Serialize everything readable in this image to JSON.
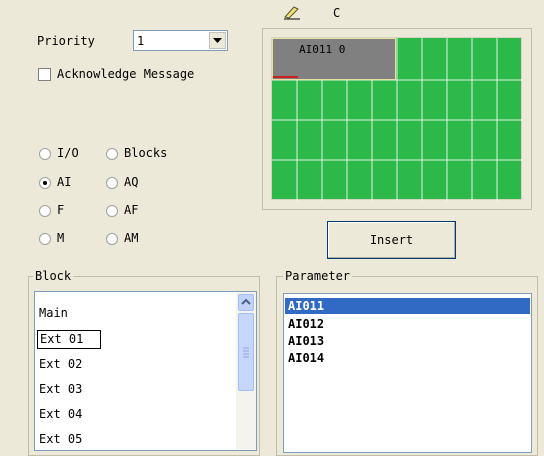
{
  "toolbar": {
    "c_label": "C",
    "icon": "pencil-icon"
  },
  "priority": {
    "label": "Priority",
    "value": "1"
  },
  "acknowledge": {
    "label": "Acknowledge Message",
    "checked": false
  },
  "radios": [
    {
      "label": "I/O",
      "checked": false
    },
    {
      "label": "Blocks",
      "checked": false
    },
    {
      "label": "AI",
      "checked": true
    },
    {
      "label": "AQ",
      "checked": false
    },
    {
      "label": "F",
      "checked": false
    },
    {
      "label": "AF",
      "checked": false
    },
    {
      "label": "M",
      "checked": false
    },
    {
      "label": "AM",
      "checked": false
    }
  ],
  "grid": {
    "selected_block_label": "AI011 0",
    "color": "#2db84a",
    "selected_color": "#808080"
  },
  "insert_button": {
    "label": "Insert"
  },
  "block": {
    "title": "Block",
    "items": [
      "Main",
      "Ext 01",
      "Ext 02",
      "Ext 03",
      "Ext 04",
      "Ext 05"
    ],
    "focused_item": "Ext 01"
  },
  "parameter": {
    "title": "Parameter",
    "items": [
      "AI011",
      "AI012",
      "AI013",
      "AI014"
    ],
    "selected_item": "AI011",
    "selection_color": "#316ac5"
  }
}
